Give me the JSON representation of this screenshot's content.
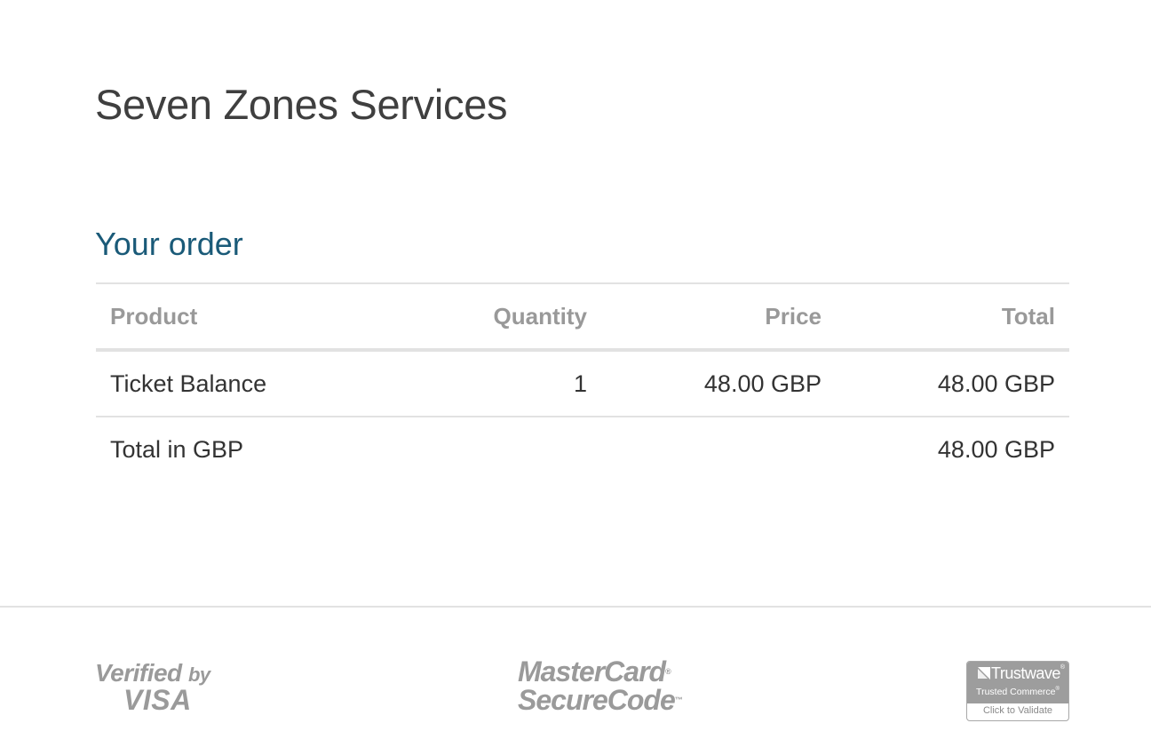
{
  "merchant": {
    "name": "Seven Zones Services"
  },
  "order": {
    "heading": "Your order",
    "columns": {
      "product": "Product",
      "quantity": "Quantity",
      "price": "Price",
      "total": "Total"
    },
    "items": [
      {
        "product": "Ticket Balance",
        "quantity": "1",
        "price": "48.00 GBP",
        "total": "48.00 GBP"
      }
    ],
    "summary": {
      "label": "Total in GBP",
      "value": "48.00 GBP"
    }
  },
  "footer": {
    "badges": {
      "visa": {
        "line1": "Verified",
        "line1_suffix": "by",
        "line2": "VISA"
      },
      "mastercard": {
        "line1": "MasterCard",
        "line1_mark": "®",
        "line2": "SecureCode",
        "line2_mark": "™"
      },
      "trustwave": {
        "brand": "Trustwave",
        "brand_mark": "®",
        "subtitle": "Trusted Commerce",
        "subtitle_mark": "®",
        "action": "Click to Validate"
      }
    }
  }
}
